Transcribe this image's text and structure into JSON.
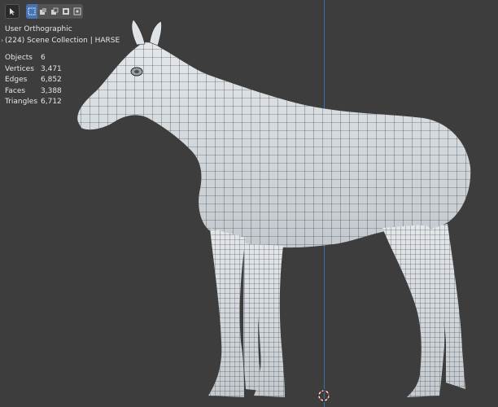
{
  "viewport": {
    "view_name": "User Orthographic",
    "collection_line": "(224) Scene Collection | HARSE"
  },
  "stats": [
    {
      "label": "Objects",
      "value": "6"
    },
    {
      "label": "Vertices",
      "value": "3,471"
    },
    {
      "label": "Edges",
      "value": "6,852"
    },
    {
      "label": "Faces",
      "value": "3,388"
    },
    {
      "label": "Triangles",
      "value": "6,712"
    }
  ],
  "toolbar": {
    "select_tool_icon": "cursor-select-icon",
    "modes": [
      "select-box-icon",
      "select-extend-icon",
      "select-subtract-icon",
      "select-invert-icon",
      "select-intersect-icon"
    ]
  },
  "colors": {
    "background": "#3d3d3d",
    "mesh_fill": "#d9dee2",
    "wire": "#262a2e",
    "axis": "#3a6ea5",
    "active_mode": "#4772b3"
  }
}
